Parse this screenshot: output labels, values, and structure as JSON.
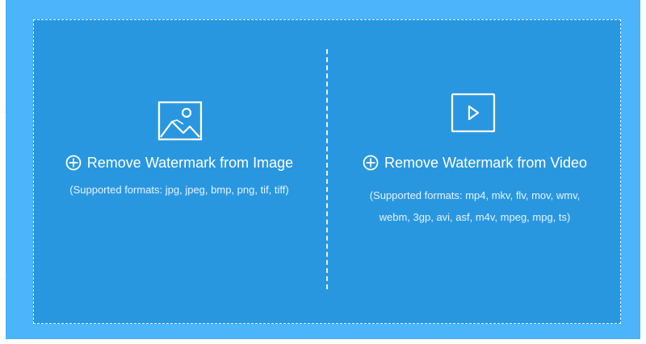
{
  "image_upload": {
    "icon": "image-icon",
    "title": "Remove Watermark from Image",
    "formats": "(Supported formats: jpg, jpeg, bmp, png, tif, tiff)"
  },
  "video_upload": {
    "icon": "video-play-icon",
    "title": "Remove Watermark from Video",
    "formats_line_1": "(Supported formats: mp4, mkv, flv, mov, wmv,",
    "formats_line_2": "webm, 3gp, avi, asf, m4v, mpeg, mpg, ts)"
  },
  "colors": {
    "outer_panel": "#4bb4fa",
    "drop_zone": "#2997e0",
    "text": "#ffffff"
  }
}
